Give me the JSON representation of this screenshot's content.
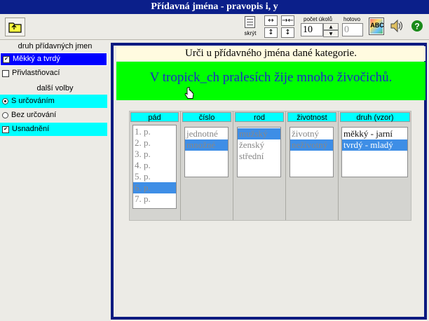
{
  "title": "Přídavná jména - pravopis i, y",
  "toolbar": {
    "skryt_label": "skrýt",
    "pocet_ukolu_label": "počet úkolů",
    "pocet_ukolu_value": "10",
    "hotovo_label": "hotovo",
    "hotovo_value": "0",
    "spell_label": "ABC"
  },
  "sidebar": {
    "section1_title": "druh přídavných jmen",
    "section1_items": [
      {
        "label": "Měkký a tvrdý",
        "checked": true,
        "selected": true
      },
      {
        "label": "Přivlastňovací",
        "checked": false,
        "selected": false
      }
    ],
    "section2_title": "další volby",
    "section2_items": [
      {
        "label": "S určováním",
        "checked": true
      },
      {
        "label": "Bez určování",
        "checked": false
      },
      {
        "label": "Usnadnění",
        "checked": true
      }
    ]
  },
  "main": {
    "instruction": "Urči u přídavného jména dané kategorie.",
    "sentence": "V tropick_ch pralesích žije mnoho živočichů."
  },
  "grammar": {
    "columns": [
      {
        "header": "pád",
        "items": [
          "1. p.",
          "2. p.",
          "3. p.",
          "4. p.",
          "5. p.",
          "6. p.",
          "7. p."
        ],
        "selected": 5
      },
      {
        "header": "číslo",
        "items": [
          "jednotné",
          "množné"
        ],
        "selected": 1
      },
      {
        "header": "rod",
        "items": [
          "mužský",
          "ženský",
          "střední"
        ],
        "selected": 0
      },
      {
        "header": "životnost",
        "items": [
          "životný",
          "neživotný"
        ],
        "selected": 1
      },
      {
        "header": "druh (vzor)",
        "items": [
          "měkký - jarní",
          "tvrdý - mladý"
        ],
        "selected": 1
      }
    ]
  },
  "colors": {
    "titlebar": "#0b1f8a",
    "frame": "#0b1a80",
    "sentence_bg": "#00ff00",
    "sentence_text": "#1a2cc4",
    "highlight_cyan": "#00ffff",
    "selection_blue": "#3e8ee6",
    "sidebar_selected": "#0000ff"
  }
}
